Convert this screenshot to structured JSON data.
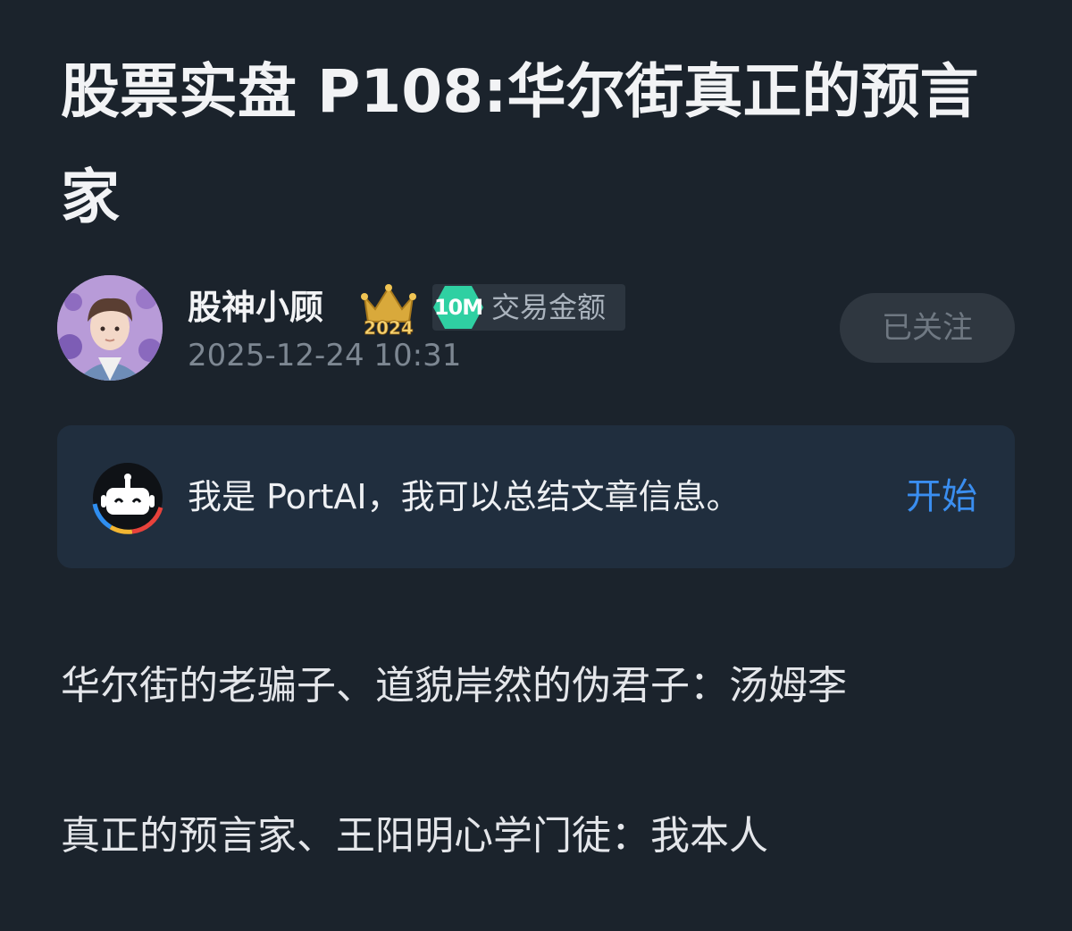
{
  "article": {
    "title": "股票实盘 P108:华尔街真正的预言家",
    "paragraphs": [
      "华尔街的老骗子、道貌岸然的伪君子：汤姆李",
      "真正的预言家、王阳明心学门徒：我本人"
    ]
  },
  "author": {
    "name": "股神小顾",
    "crown_year": "2024",
    "badge_value": "10M",
    "badge_label": "交易金额",
    "post_time": "2025-12-24 10:31",
    "follow_label": "已关注"
  },
  "ai_card": {
    "message": "我是 PortAI，我可以总结文章信息。",
    "action_label": "开始"
  },
  "colors": {
    "background": "#1b232c",
    "accent": "#3a8ef0",
    "badge_green": "#2fd0a2",
    "card_bg": "#202e3e"
  },
  "icons": [
    "avatar-image",
    "crown-icon",
    "badge-hex-icon",
    "portai-robot-icon"
  ]
}
